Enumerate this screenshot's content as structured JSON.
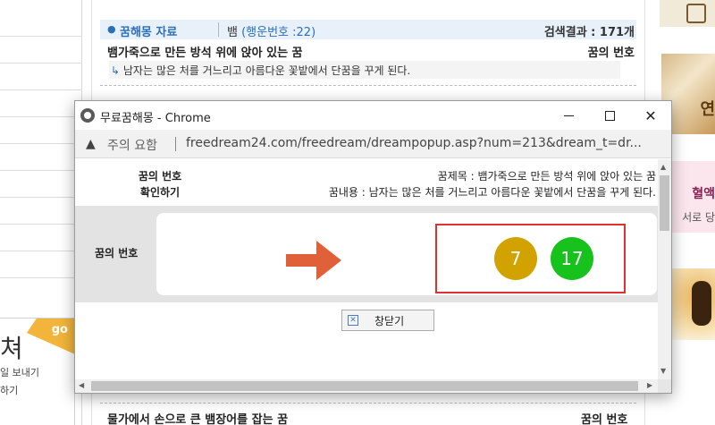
{
  "background": {
    "header": {
      "category": "꿈해몽 자료",
      "keyword": "뱀",
      "lucky_number": "(행운번호 :22)",
      "result_count": "검색결과 : 171개"
    },
    "rows": [
      {
        "title": "뱀가죽으로 만든 방석 위에 앉아 있는 꿈",
        "number_label": "꿈의 번호",
        "description": "남자는 많은 처를 거느리고 아름다운 꽃밭에서 단꿈을 꾸게 된다."
      }
    ],
    "bottom_row": {
      "title": "물가에서 손으로 큰 뱀장어를 잡는 꿈",
      "number_label": "꿈의 번호"
    },
    "left_panel": {
      "big_text": "쳐",
      "go": "go",
      "line1": "일 보내기",
      "line2": "하기"
    },
    "right_ads": {
      "ad1": "연",
      "ad2_title": "혈액",
      "ad2_sub": "서로 당"
    }
  },
  "popup": {
    "window_title": "무료꿈해몽 - Chrome",
    "security_label": "주의 요함",
    "url": "freedream24.com/freedream/dreampopup.asp?num=213&dream_t=dr...",
    "info": {
      "label_line1": "꿈의 번호",
      "label_line2": "확인하기",
      "dream_title": "꿈제목 : 뱀가죽으로 만든 방석 위에 앉아 있는 꿈",
      "dream_content": "꿈내용 : 남자는 많은 처를 거느리고 아름다운 꽃밭에서 단꿈을 꾸게 된다."
    },
    "numbers_label": "꿈의 번호",
    "numbers": [
      {
        "value": "7",
        "color": "#d1a200"
      },
      {
        "value": "17",
        "color": "#18c21c"
      }
    ],
    "close_button": "창닫기",
    "colors": {
      "arrow": "#e0603a",
      "highlight_box": "#e03030"
    }
  }
}
